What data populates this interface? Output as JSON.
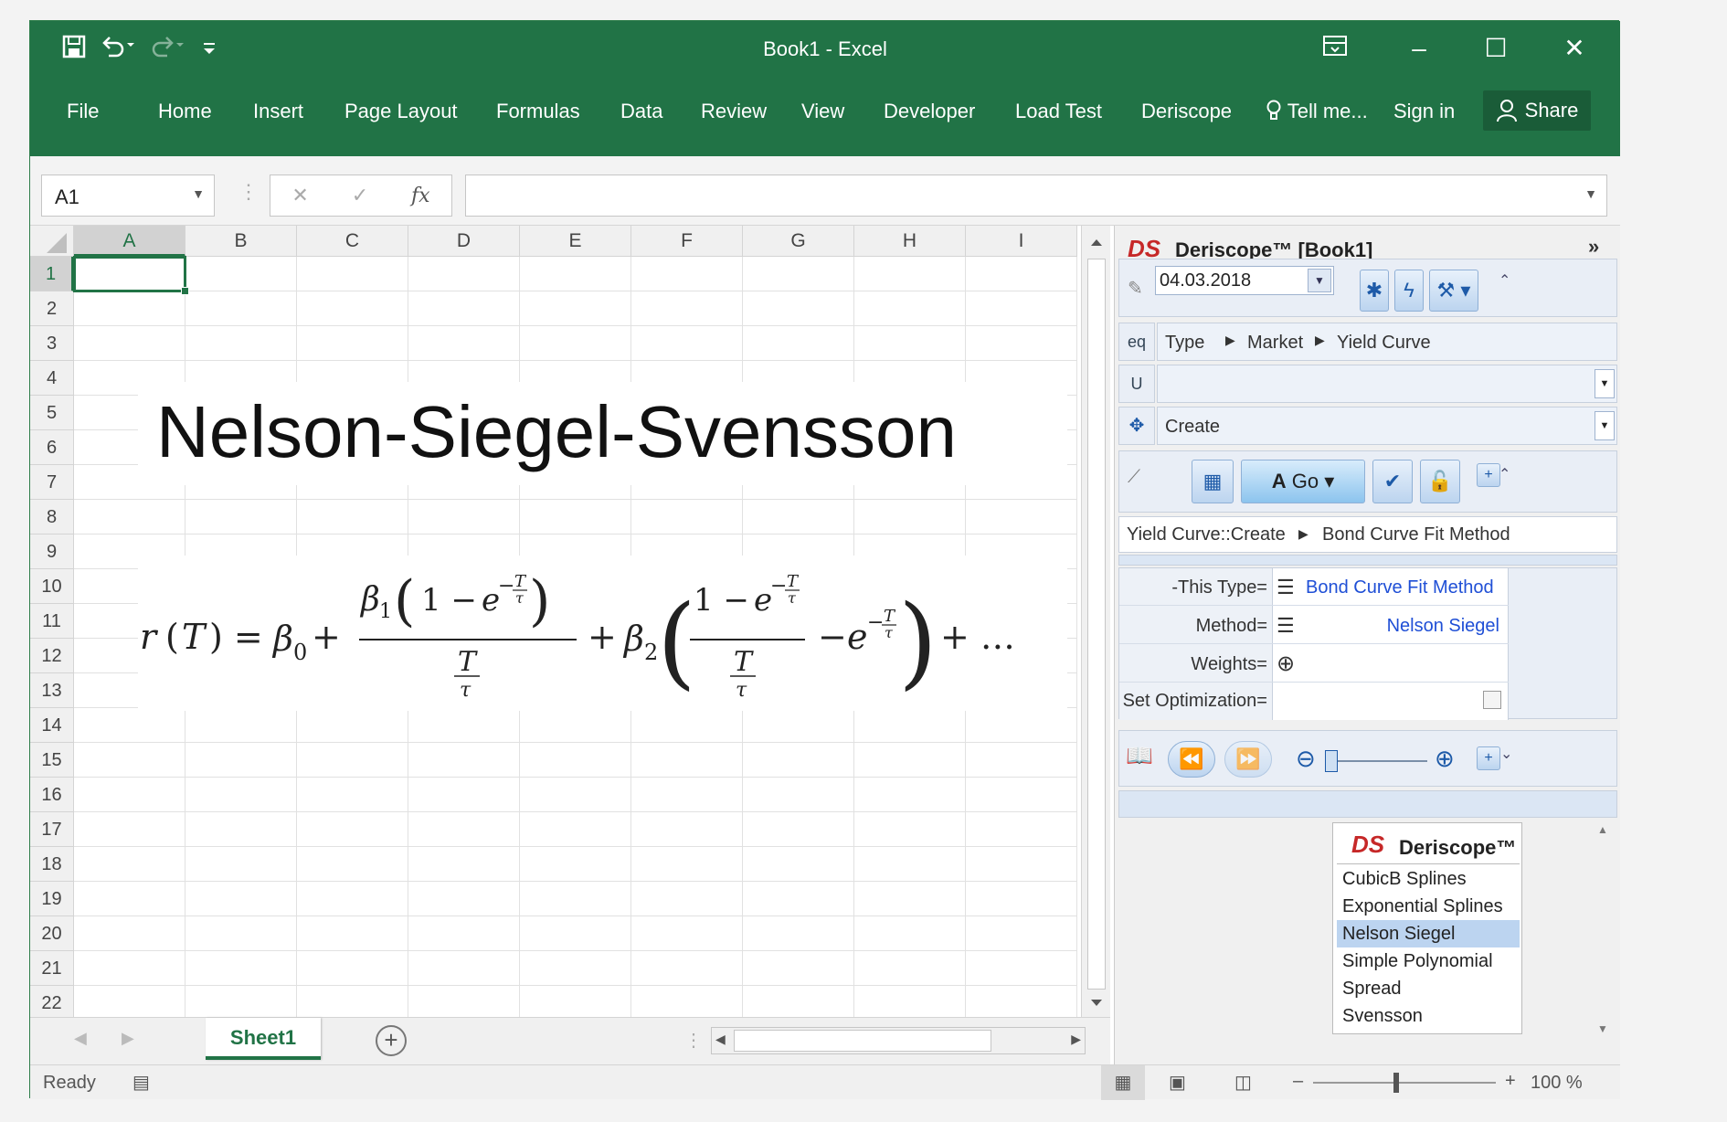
{
  "window": {
    "title": "Book1 - Excel",
    "quick_access": {
      "save_icon": "save-icon",
      "undo_icon": "undo-icon",
      "redo_icon": "redo-icon",
      "customize_icon": "customize-icon"
    },
    "controls": {
      "restore_ribbon": "ribbon-display-icon",
      "minimize": "–",
      "maximize": "☐",
      "close": "✕"
    }
  },
  "ribbon": {
    "tabs": [
      "File",
      "Home",
      "Insert",
      "Page Layout",
      "Formulas",
      "Data",
      "Review",
      "View",
      "Developer",
      "Load Test",
      "Deriscope"
    ],
    "tell_me": "Tell me...",
    "sign_in": "Sign in",
    "share": "Share"
  },
  "formula_bar": {
    "name_box": "A1",
    "fx": "fx",
    "value": ""
  },
  "grid": {
    "columns": [
      "A",
      "B",
      "C",
      "D",
      "E",
      "F",
      "G",
      "H",
      "I"
    ],
    "rows": [
      "1",
      "2",
      "3",
      "4",
      "5",
      "6",
      "7",
      "8",
      "9",
      "10",
      "11",
      "12",
      "13",
      "14",
      "15",
      "16",
      "17",
      "18",
      "19",
      "20",
      "21",
      "22"
    ],
    "selected_column": "A",
    "selected_row": "1"
  },
  "content": {
    "title": "Nelson-Siegel-Svensson",
    "formula": "r(T) = β0 + β1(1 − e^(−T/τ))/(T/τ) + β2((1 − e^(−T/τ))/(T/τ) − e^(−T/τ)) + …"
  },
  "sheets": {
    "active": "Sheet1"
  },
  "status": {
    "text": "Ready",
    "zoom": "100 %"
  },
  "deriscope": {
    "logo": "DS",
    "title": "Deriscope™ [Book1]",
    "date": "04.03.2018",
    "eq_label": "eq",
    "path": [
      "Type",
      "Market",
      "Yield Curve"
    ],
    "u_label": "U",
    "action": "Create",
    "go_label": "Go",
    "breadcrumb": [
      "Yield Curve::Create",
      "Bond Curve Fit Method"
    ],
    "properties": [
      {
        "name": "-This Type=",
        "value": "Bond Curve Fit Method"
      },
      {
        "name": "Method=",
        "value": "Nelson Siegel"
      },
      {
        "name": "Weights=",
        "value": ""
      },
      {
        "name": "Set Optimization=",
        "value": ""
      }
    ],
    "dropdown": {
      "header": "Deriscope™",
      "options": [
        "CubicB Splines",
        "Exponential Splines",
        "Nelson Siegel",
        "Simple Polynomial",
        "Spread",
        "Svensson"
      ],
      "selected": "Nelson Siegel"
    }
  }
}
